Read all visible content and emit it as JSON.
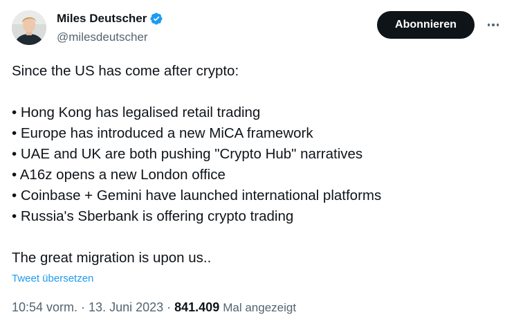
{
  "author": {
    "display_name": "Miles Deutscher",
    "handle": "@milesdeutscher",
    "verified_icon": "verified-badge-icon",
    "verified_color": "#1d9bf0"
  },
  "actions": {
    "follow_label": "Abonnieren",
    "more_icon": "more-horizontal-icon"
  },
  "tweet": {
    "intro": "Since the US has come after crypto:",
    "bullets": [
      "• Hong Kong has legalised retail trading",
      "• Europe has introduced a new MiCA framework",
      "• UAE and UK are both pushing \"Crypto Hub\" narratives",
      "• A16z opens a new London office",
      "• Coinbase + Gemini have launched international platforms",
      "• Russia's Sberbank is offering crypto trading"
    ],
    "closing": "The great migration is upon us..",
    "translate_label": "Tweet übersetzen"
  },
  "meta": {
    "time": "10:54 vorm.",
    "separator": " · ",
    "date": "13. Juni 2023",
    "views_count": "841.409",
    "views_label": "Mal angezeigt"
  },
  "colors": {
    "text": "#0f1419",
    "secondary": "#536471",
    "link": "#1d9bf0",
    "button_bg": "#0f1419"
  }
}
